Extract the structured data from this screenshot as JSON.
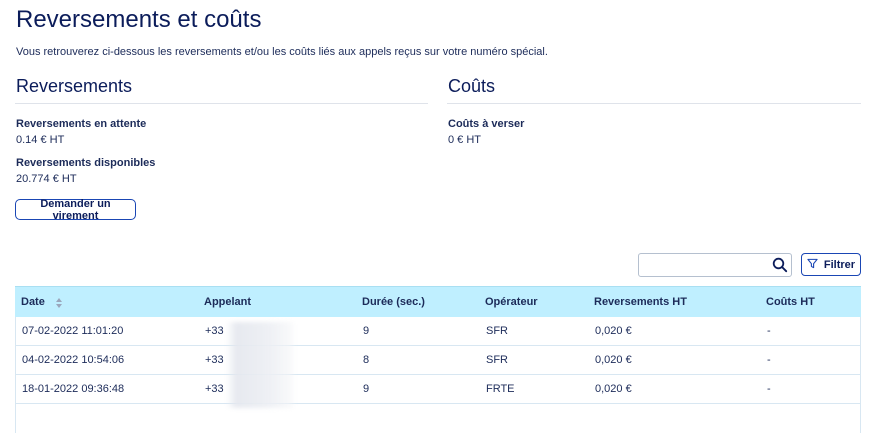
{
  "page": {
    "title": "Reversements et coûts",
    "intro": "Vous retrouverez ci-dessous les reversements et/ou les coûts liés aux appels reçus sur votre numéro spécial."
  },
  "reversements": {
    "title": "Reversements",
    "pending_label": "Reversements en attente",
    "pending_value": "0.14 € HT",
    "available_label": "Reversements disponibles",
    "available_value": "20.774 € HT",
    "transfer_button": "Demander un virement"
  },
  "couts": {
    "title": "Coûts",
    "due_label": "Coûts à verser",
    "due_value": "0 € HT"
  },
  "toolbar": {
    "search_value": "",
    "search_placeholder": "",
    "filter_label": "Filtrer"
  },
  "table": {
    "headers": [
      "Date",
      "Appelant",
      "Durée (sec.)",
      "Opérateur",
      "Reversements HT",
      "Coûts HT"
    ],
    "rows": [
      [
        "07-02-2022 11:01:20",
        "+33",
        "9",
        "SFR",
        "0,020 €",
        "-"
      ],
      [
        "04-02-2022 10:54:06",
        "+33",
        "8",
        "SFR",
        "0,020 €",
        "-"
      ],
      [
        "18-01-2022 09:36:48",
        "+33",
        "9",
        "FRTE",
        "0,020 €",
        "-"
      ]
    ]
  },
  "colors": {
    "accent": "#1a46b4",
    "header_bg": "#bfefff",
    "title": "#0b1c5a"
  }
}
